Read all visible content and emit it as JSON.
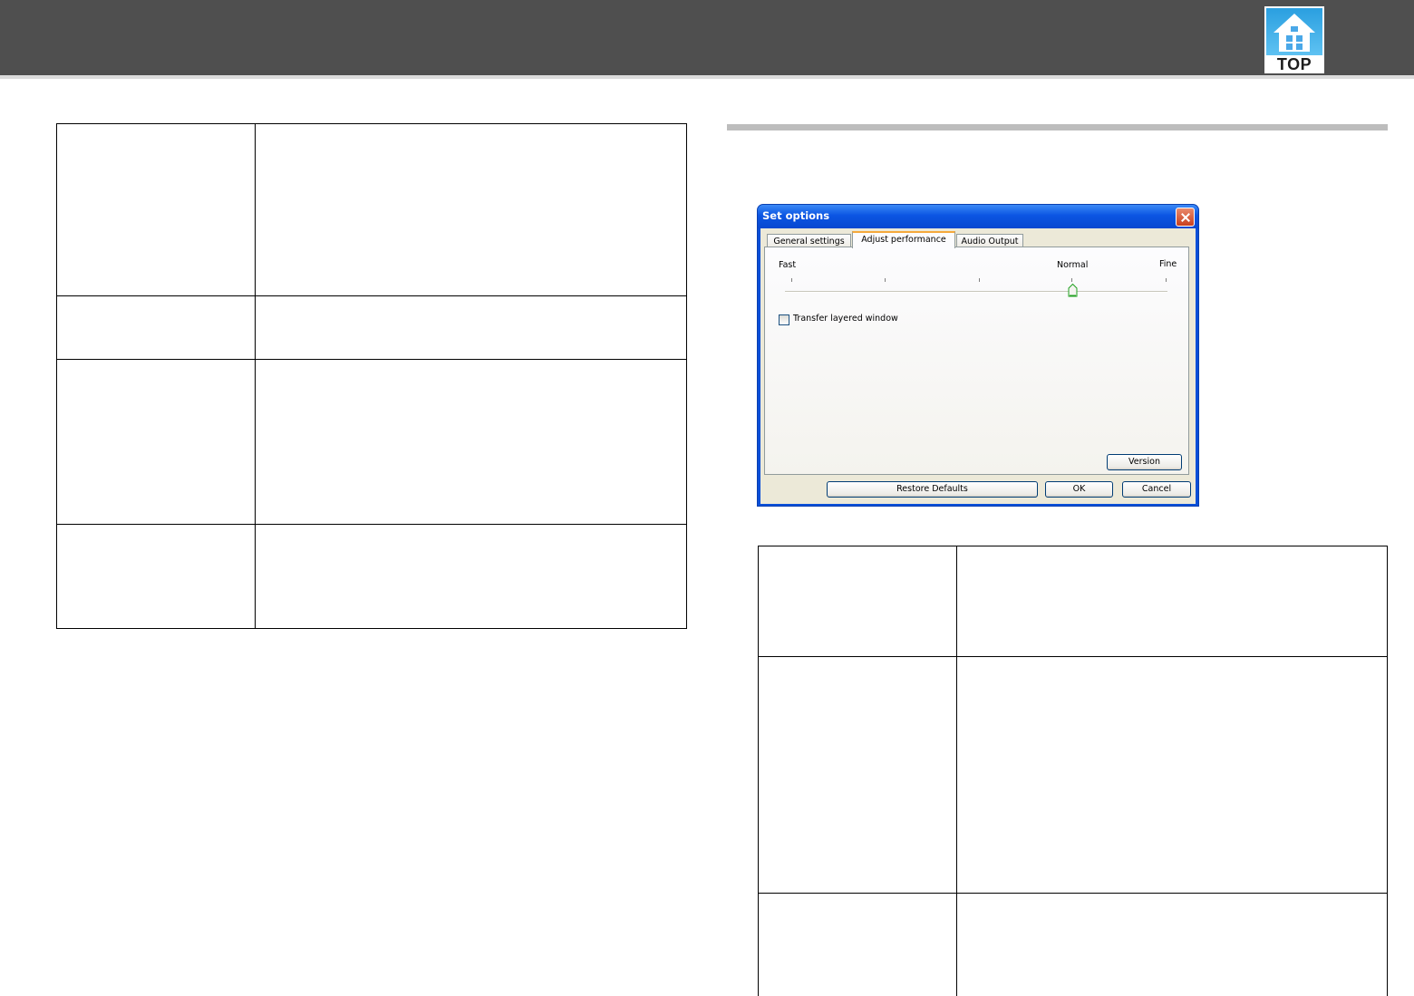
{
  "header": {
    "top_label": "TOP"
  },
  "dialog": {
    "title": "Set options",
    "tabs": [
      "General settings",
      "Adjust performance",
      "Audio Output"
    ],
    "active_tab": "Adjust performance",
    "slider": {
      "label_left": "Fast",
      "label_mid": "Normal",
      "label_right": "Fine",
      "positions": 5,
      "value_index": 3
    },
    "checkbox": {
      "label": "Transfer layered window",
      "checked": false
    },
    "buttons": {
      "version": "Version",
      "restore": "Restore Defaults",
      "ok": "OK",
      "cancel": "Cancel"
    }
  },
  "colors": {
    "header": "#4f4f4f",
    "titlebar": "#0b55e3",
    "dialog_face": "#ece9d8"
  }
}
